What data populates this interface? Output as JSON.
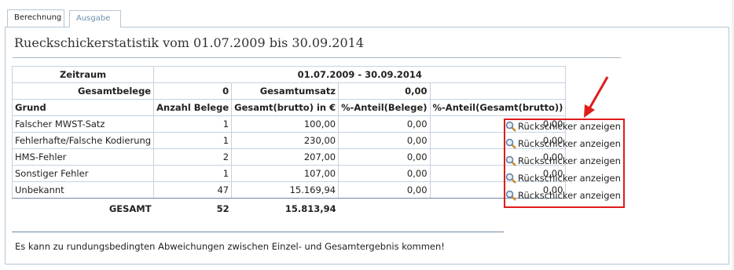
{
  "tabs": [
    {
      "label": "Berechnung",
      "active": true
    },
    {
      "label": "Ausgabe",
      "active": false
    }
  ],
  "title": "Rueckschickerstatistik vom 01.07.2009 bis 30.09.2014",
  "table": {
    "zeitraum_label": "Zeitraum",
    "zeitraum_value": "01.07.2009 - 30.09.2014",
    "gesamtbelege_label": "Gesamtbelege",
    "gesamtbelege_value": "0",
    "gesamtumsatz_label": "Gesamtumsatz",
    "gesamtumsatz_value": "0,00",
    "headers": [
      "Grund",
      "Anzahl Belege",
      "Gesamt(brutto) in €",
      "%-Anteil(Belege)",
      "%-Anteil(Gesamt(brutto))"
    ],
    "rows": [
      {
        "grund": "Falscher MWST-Satz",
        "anzahl": "1",
        "gesamt": "100,00",
        "anteil_belege": "0,00",
        "anteil_gesamt": "0,00"
      },
      {
        "grund": "Fehlerhafte/Falsche Kodierung",
        "anzahl": "1",
        "gesamt": "230,00",
        "anteil_belege": "0,00",
        "anteil_gesamt": "0,00"
      },
      {
        "grund": "HMS-Fehler",
        "anzahl": "2",
        "gesamt": "207,00",
        "anteil_belege": "0,00",
        "anteil_gesamt": "0,00"
      },
      {
        "grund": "Sonstiger Fehler",
        "anzahl": "1",
        "gesamt": "107,00",
        "anteil_belege": "0,00",
        "anteil_gesamt": "0,00"
      },
      {
        "grund": "Unbekannt",
        "anzahl": "47",
        "gesamt": "15.169,94",
        "anteil_belege": "0,00",
        "anteil_gesamt": "0,00"
      }
    ],
    "sum_label": "GESAMT",
    "sum_anzahl": "52",
    "sum_gesamt": "15.813,94"
  },
  "row_action_label": "Rückschicker anzeigen",
  "row_action_icon": "magnifier-icon",
  "highlight_color": "#e01b1b",
  "note": "Es kann zu rundungsbedingten Abweichungen zwischen Einzel- und Gesamtergebnis kommen!"
}
